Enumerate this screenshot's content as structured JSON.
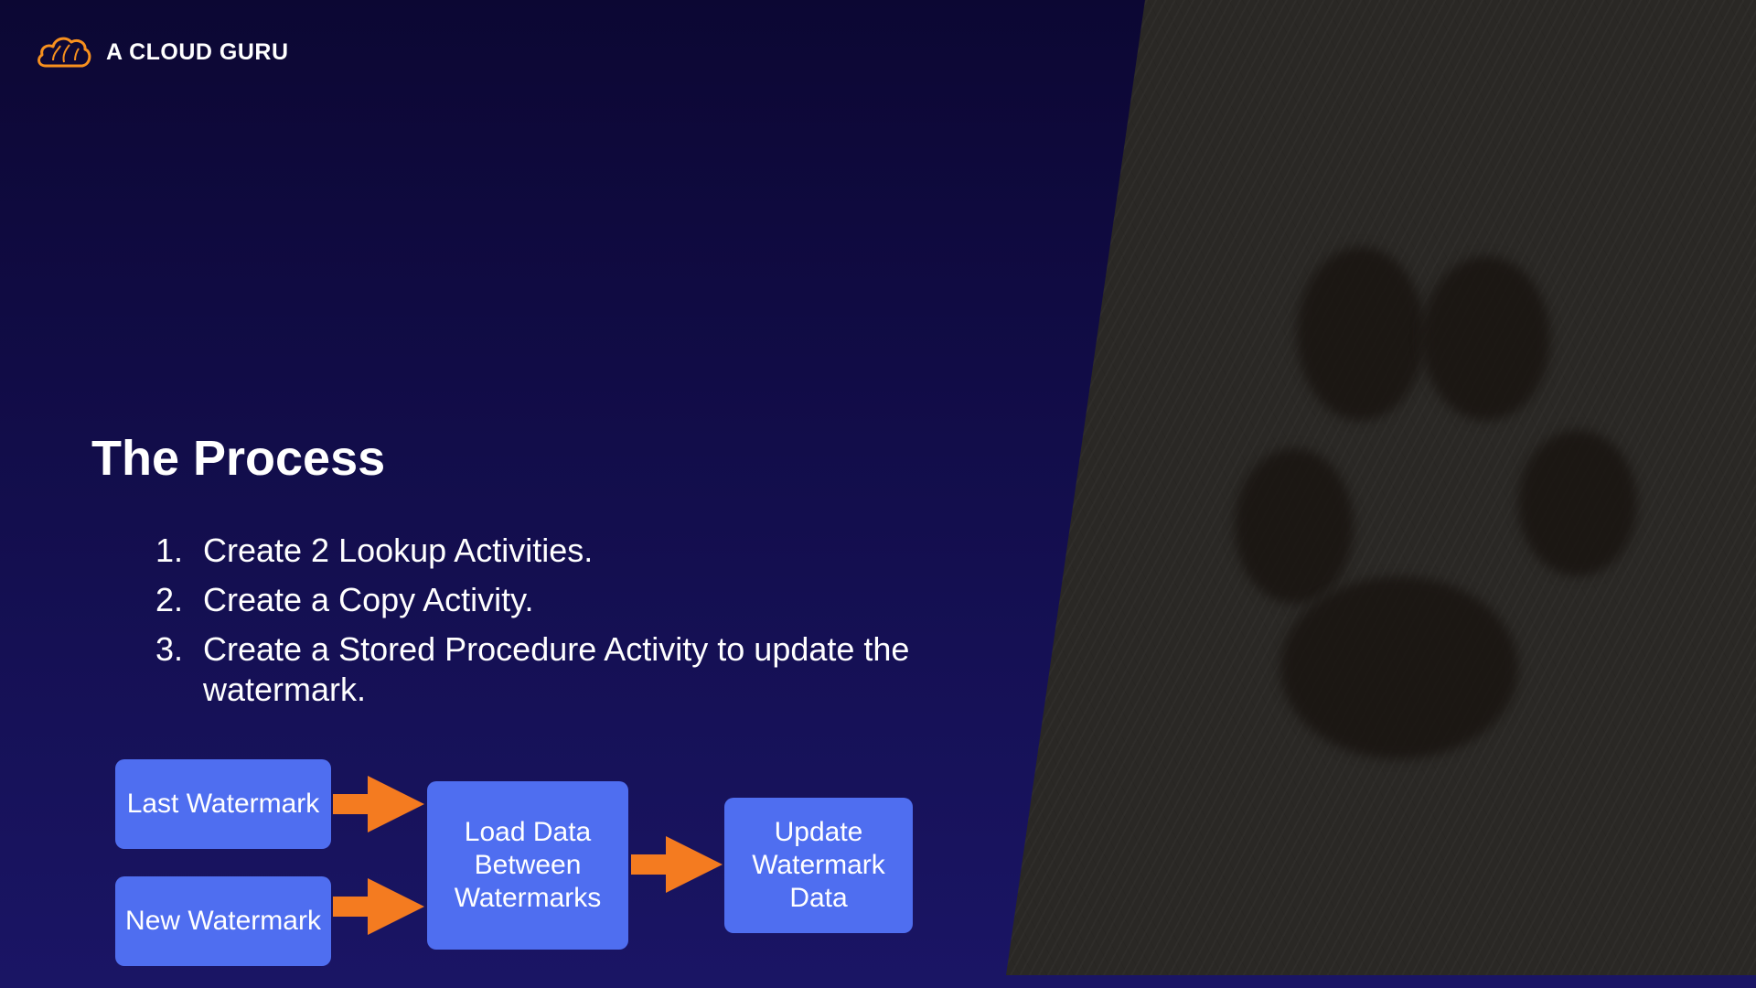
{
  "brand": {
    "name": "A CLOUD GURU",
    "icon": "cloud-icon",
    "accent_color": "#f7901e"
  },
  "slide": {
    "title": "The Process",
    "steps": [
      {
        "number": "1.",
        "text": "Create 2 Lookup Activities."
      },
      {
        "number": "2.",
        "text": "Create a Copy Activity."
      },
      {
        "number": "3.",
        "text": "Create a Stored Procedure Activity to update the watermark."
      }
    ]
  },
  "diagram": {
    "box_color": "#4f6ef0",
    "arrow_color": "#f47b20",
    "nodes": {
      "last_watermark": "Last Watermark",
      "new_watermark": "New Watermark",
      "load_data": "Load Data Between Watermarks",
      "update_watermark": "Update Watermark Data"
    }
  }
}
